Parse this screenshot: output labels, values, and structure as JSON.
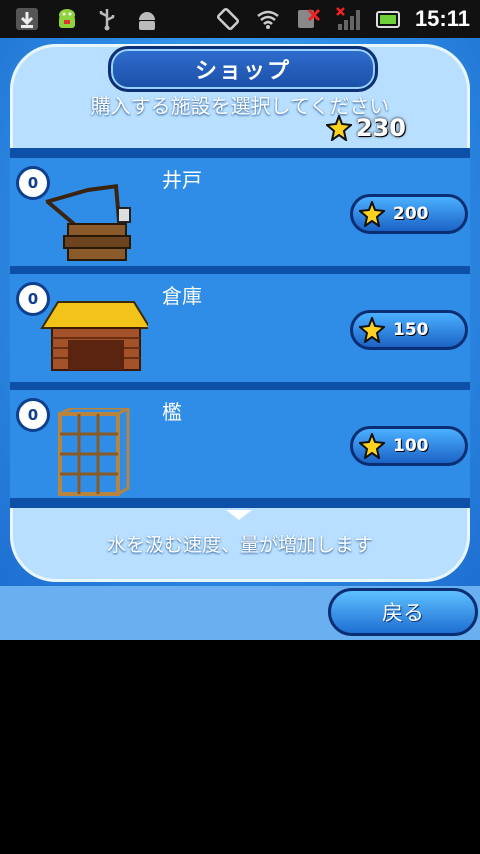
{
  "status_bar": {
    "time": "15:11",
    "icons": [
      "download-icon",
      "android-mascot-icon",
      "usb-icon",
      "android-debug-icon",
      "screen-rotate-icon",
      "wifi-icon",
      "no-signal-icon",
      "signal-bars-icon",
      "battery-icon"
    ]
  },
  "shop": {
    "title": "ショップ",
    "subtitle": "購入する施設を選択してください",
    "coins": "230",
    "items": [
      {
        "name": "井戸",
        "count": "0",
        "price": "200",
        "icon": "well-icon"
      },
      {
        "name": "倉庫",
        "count": "0",
        "price": "150",
        "icon": "storehouse-icon"
      },
      {
        "name": "檻",
        "count": "0",
        "price": "100",
        "icon": "cage-icon"
      }
    ],
    "description": "水を汲む速度、量が増加します",
    "back_label": "戻る"
  },
  "colors": {
    "accent_blue": "#2f8de8",
    "dark_blue": "#0e4fa8",
    "star_yellow": "#ffd21f"
  }
}
